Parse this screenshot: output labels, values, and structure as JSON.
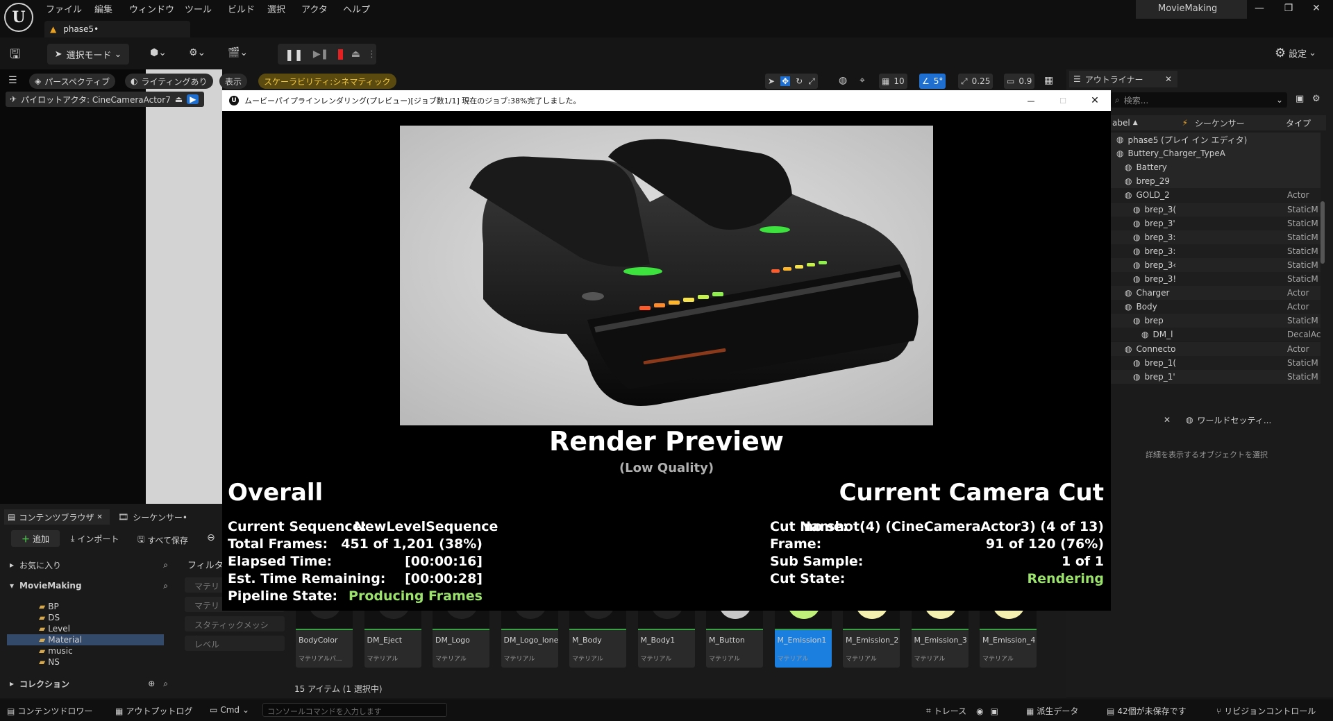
{
  "menu": [
    "ファイル",
    "編集",
    "ウィンドウ",
    "ツール",
    "ビルド",
    "選択",
    "アクタ",
    "ヘルプ"
  ],
  "tab": {
    "label": "phase5•"
  },
  "project_name": "MovieMaking",
  "toolbar": {
    "mode_label": "選択モード",
    "settings_label": "設定"
  },
  "viewport": {
    "perspective": "パースペクティブ",
    "lighting": "ライティングあり",
    "show": "表示",
    "scalability": "スケーラビリティ:シネマティック",
    "pilot": "パイロットアクタ: CineCameraActor7",
    "grid_value": "10",
    "angle_value": "5°",
    "scale_value": "0.25",
    "camera_speed": "0.9"
  },
  "dialog": {
    "title": "ムービーパイプラインレンダリング(プレビュー)[ジョブ数1/1] 現在のジョブ:38%完了しました。",
    "render_title": "Render Preview",
    "render_sub": "(Low Quality)",
    "overall_title": "Overall",
    "cut_title": "Current Camera Cut",
    "overall": [
      {
        "label": "Current Sequence:",
        "value": "NewLevelSequence"
      },
      {
        "label": "Total Frames:",
        "value": "451 of 1,201 (38%)"
      },
      {
        "label": "Elapsed Time:",
        "value": "[00:00:16]"
      },
      {
        "label": "Est. Time Remaining:",
        "value": "[00:00:28]"
      },
      {
        "label": "Pipeline State:",
        "value": "Producing Frames"
      }
    ],
    "cut": [
      {
        "label": "Cut Name:",
        "value": "no shot(4) (CineCameraActor3) (4 of 13)"
      },
      {
        "label": "Frame:",
        "value": "91 of 120 (76%)"
      },
      {
        "label": "Sub Sample:",
        "value": "1 of 1"
      },
      {
        "label": "Cut State:",
        "value": "Rendering"
      }
    ],
    "accent_green": "#9be36b"
  },
  "outliner": {
    "tab": "アウトライナー",
    "search_placeholder": "検索...",
    "col_label": "abel",
    "col_sequencer": "シーケンサー",
    "col_type": "タイプ",
    "rows": [
      {
        "name": "phase5 (プレイ イン エディタ)",
        "type": ""
      },
      {
        "name": "Buttery_Charger_TypeA",
        "type": ""
      },
      {
        "name": "Battery",
        "type": ""
      },
      {
        "name": "brep_29",
        "type": ""
      },
      {
        "name": "GOLD_2",
        "type": "Actor"
      },
      {
        "name": "brep_3(",
        "type": "StaticM"
      },
      {
        "name": "brep_3'",
        "type": "StaticM"
      },
      {
        "name": "brep_3:",
        "type": "StaticM"
      },
      {
        "name": "brep_3:",
        "type": "StaticM"
      },
      {
        "name": "brep_3‹",
        "type": "StaticM"
      },
      {
        "name": "brep_3!",
        "type": "StaticM"
      },
      {
        "name": "Charger",
        "type": "Actor"
      },
      {
        "name": "Body",
        "type": "Actor"
      },
      {
        "name": "brep",
        "type": "StaticM"
      },
      {
        "name": "DM_l",
        "type": "DecalAc"
      },
      {
        "name": "Connecto",
        "type": "Actor"
      },
      {
        "name": "brep_1(",
        "type": "StaticM"
      },
      {
        "name": "brep_1'",
        "type": "StaticM"
      }
    ]
  },
  "details": {
    "tab": "ワールドセッティ...",
    "empty_text": "詳細を表示するオブジェクトを選択"
  },
  "content_browser": {
    "tab1": "コンテンツブラウザ",
    "tab2": "シーケンサー•",
    "add": "追加",
    "import": "インポート",
    "save_all": "すべて保存",
    "favorites": "お気に入り",
    "root": "MovieMaking",
    "folders": [
      "BP",
      "DS",
      "Level",
      "Material",
      "music",
      "NS"
    ],
    "collections": "コレクション",
    "filter_label": "フィルタ",
    "filters": [
      "マテリ",
      "マテリ",
      "スタティックメッシュ",
      "レベル"
    ],
    "assets": [
      {
        "name": "BodyColor",
        "type": "マテリアルパ..."
      },
      {
        "name": "DM_Eject",
        "type": "マテリアル"
      },
      {
        "name": "DM_Logo",
        "type": "マテリアル"
      },
      {
        "name": "DM_Logo_lone",
        "type": "マテリアル"
      },
      {
        "name": "M_Body",
        "type": "マテリアル"
      },
      {
        "name": "M_Body1",
        "type": "マテリアル"
      },
      {
        "name": "M_Button",
        "type": "マテリアル"
      },
      {
        "name": "M_Emission1",
        "type": "マテリアル"
      },
      {
        "name": "M_Emission_2",
        "type": "マテリアル"
      },
      {
        "name": "M_Emission_3",
        "type": "マテリアル"
      },
      {
        "name": "M_Emission_4",
        "type": "マテリアル"
      }
    ],
    "item_count": "15 アイテム (1 選択中)"
  },
  "statusbar": {
    "drawer": "コンテンツドロワー",
    "output_log": "アウトプットログ",
    "cmd": "Cmd",
    "console_placeholder": "コンソールコマンドを入力します",
    "trace": "トレース",
    "derived": "派生データ",
    "unsaved": "42個が未保存です",
    "revision": "リビジョンコントロール"
  }
}
